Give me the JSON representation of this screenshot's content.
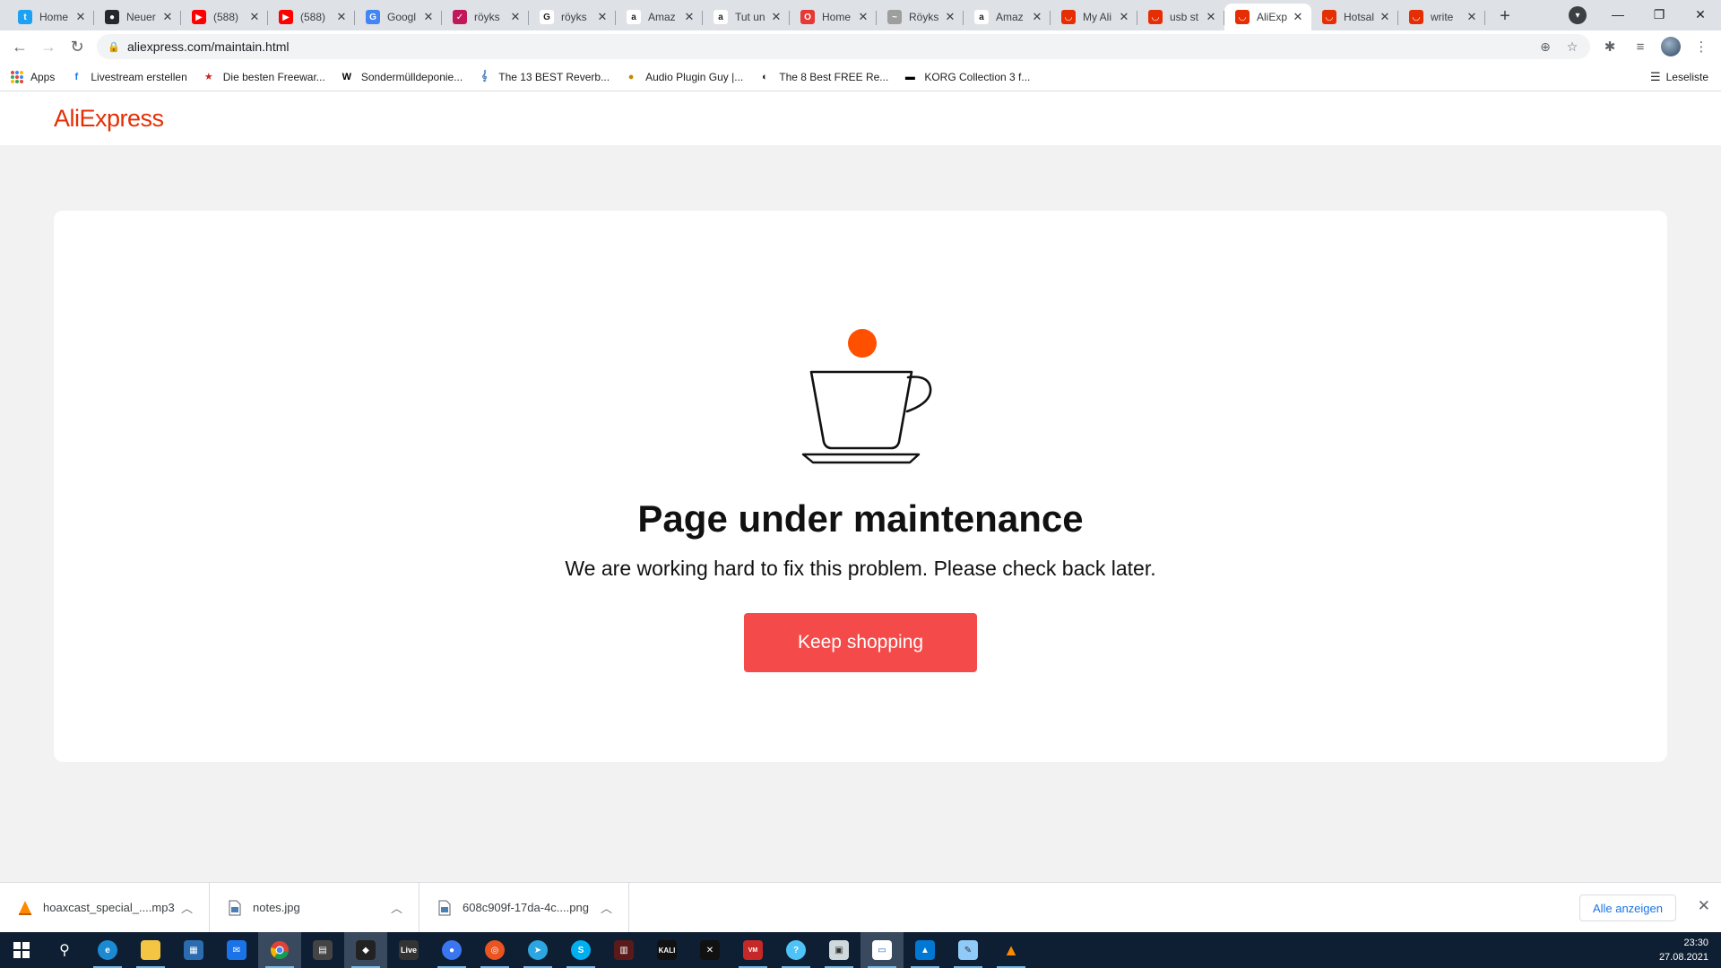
{
  "browser": {
    "tabs": [
      {
        "title": "Home",
        "favicon": "twitter-icon",
        "color": "#1da1f2",
        "glyph": "t"
      },
      {
        "title": "Neuer",
        "favicon": "github-icon",
        "color": "#24292e",
        "glyph": "●"
      },
      {
        "title": "(588)",
        "favicon": "youtube-icon",
        "color": "#ff0000",
        "glyph": "▶"
      },
      {
        "title": "(588)",
        "favicon": "youtube-icon",
        "color": "#ff0000",
        "glyph": "▶"
      },
      {
        "title": "Googl",
        "favicon": "google-translate-icon",
        "color": "#4285f4",
        "glyph": "G"
      },
      {
        "title": "röyks",
        "favicon": "bookmark-icon",
        "color": "#c2185b",
        "glyph": "✓"
      },
      {
        "title": "röyks",
        "favicon": "google-icon",
        "color": "#ffffff",
        "glyph": "G"
      },
      {
        "title": "Amaz",
        "favicon": "amazon-icon",
        "color": "#ffffff",
        "glyph": "a"
      },
      {
        "title": "Tut un",
        "favicon": "amazon-icon",
        "color": "#ffffff",
        "glyph": "a"
      },
      {
        "title": "Home",
        "favicon": "opera-icon",
        "color": "#e53935",
        "glyph": "O"
      },
      {
        "title": "Röyks",
        "favicon": "bird-icon",
        "color": "#9e9e9e",
        "glyph": "~"
      },
      {
        "title": "Amaz",
        "favicon": "amazon-icon",
        "color": "#ffffff",
        "glyph": "a"
      },
      {
        "title": "My Ali",
        "favicon": "aliexpress-icon",
        "color": "#e62e04",
        "glyph": "◡"
      },
      {
        "title": "usb st",
        "favicon": "aliexpress-icon",
        "color": "#e62e04",
        "glyph": "◡"
      },
      {
        "title": "AliExp",
        "favicon": "aliexpress-icon",
        "color": "#e62e04",
        "glyph": "◡",
        "active": true
      },
      {
        "title": "Hotsal",
        "favicon": "aliexpress-icon",
        "color": "#e62e04",
        "glyph": "◡"
      },
      {
        "title": "write",
        "favicon": "aliexpress-icon",
        "color": "#e62e04",
        "glyph": "◡"
      }
    ],
    "url": "aliexpress.com/maintain.html",
    "bookmarks": [
      {
        "label": "Livestream erstellen",
        "icon": "facebook-icon",
        "color": "#1877f2",
        "glyph": "f"
      },
      {
        "label": "Die besten Freewar...",
        "icon": "star-icon",
        "color": "#c62828",
        "glyph": "★"
      },
      {
        "label": "Sondermülldeponie...",
        "icon": "wikipedia-icon",
        "color": "#000000",
        "glyph": "W"
      },
      {
        "label": "The 13 BEST Reverb...",
        "icon": "music-icon",
        "color": "#4a7fb5",
        "glyph": "𝄞"
      },
      {
        "label": "Audio Plugin Guy |...",
        "icon": "plugin-icon",
        "color": "#c08a00",
        "glyph": "●"
      },
      {
        "label": "The 8 Best FREE Re...",
        "icon": "moon-icon",
        "color": "#222222",
        "glyph": "◐"
      },
      {
        "label": "KORG Collection 3 f...",
        "icon": "korg-icon",
        "color": "#000000",
        "glyph": "▬"
      }
    ],
    "apps_label": "Apps",
    "reading_list_label": "Leseliste"
  },
  "page": {
    "logo_text": "AliExpress",
    "title": "Page under maintenance",
    "message": "We are working hard to fix this problem. Please check back later.",
    "cta_label": "Keep shopping",
    "accent_color": "#f44a4a",
    "dot_color": "#ff5000"
  },
  "downloads": {
    "items": [
      {
        "name": "hoaxcast_special_....mp3",
        "icon": "vlc-icon"
      },
      {
        "name": "notes.jpg",
        "icon": "image-file-icon"
      },
      {
        "name": "608c909f-17da-4c....png",
        "icon": "image-file-icon"
      }
    ],
    "show_all_label": "Alle anzeigen"
  },
  "taskbar": {
    "time": "23:30",
    "date": "27.08.2021"
  }
}
